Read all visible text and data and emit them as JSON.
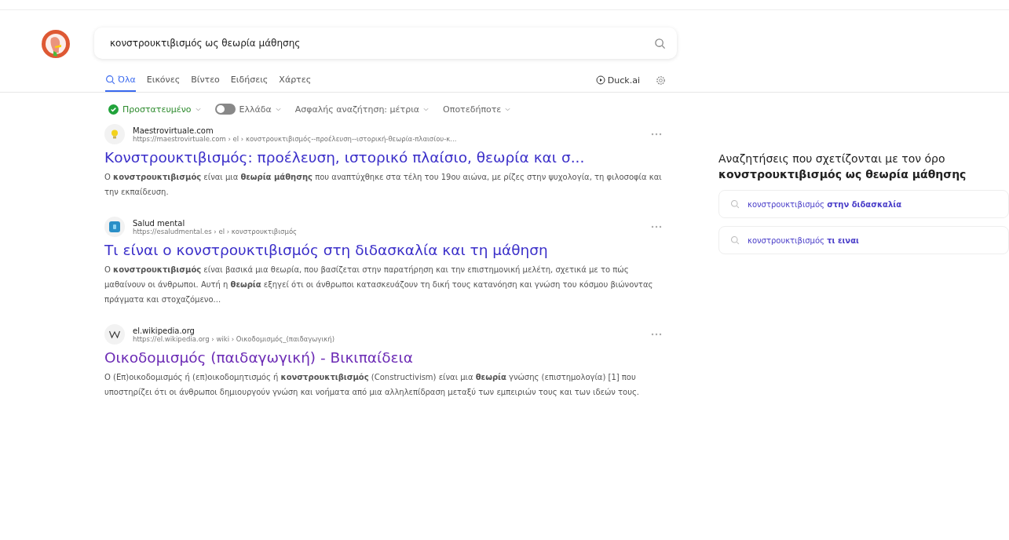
{
  "search": {
    "value": "κονστρουκτιβισμός ως θεωρία μάθησης"
  },
  "tabs": [
    {
      "label": "Όλα",
      "selected": true
    },
    {
      "label": "Εικόνες",
      "selected": false
    },
    {
      "label": "Βίντεο",
      "selected": false
    },
    {
      "label": "Ειδήσεις",
      "selected": false
    },
    {
      "label": "Χάρτες",
      "selected": false
    }
  ],
  "duck_ai": "Duck.ai",
  "filters": [
    {
      "kind": "protected",
      "label": "Προστατευμένο"
    },
    {
      "kind": "toggle",
      "label": "Ελλάδα",
      "on": false
    },
    {
      "kind": "plain",
      "label": "Ασφαλής αναζήτηση: μέτρια"
    },
    {
      "kind": "plain",
      "label": "Οποτεδήποτε"
    }
  ],
  "results": [
    {
      "kind": "bulb",
      "site": "Maestrovirtuale.com",
      "url": "https://maestrovirtuale.com › el › κονστρουκτιβισμός--προέλευση--ιστορική-θεωρία-πλαισίου-κ...",
      "title": "Κονστρουκτιβισμός: προέλευση, ιστορικό πλαίσιο, θεωρία και σ...",
      "visited": false,
      "snippet": "Ο **κονστρουκτιβισμός** είναι μια **θεωρία μάθησης** που αναπτύχθηκε στα τέλη του 19ου αιώνα, με ρίζες στην ψυχολογία, τη φιλοσοφία και την εκπαίδευση."
    },
    {
      "kind": "square",
      "site": "Salud mental",
      "url": "https://esaludmental.es › el › κονστρουκτιβισμός",
      "title": "Τι είναι ο κονστρουκτιβισμός στη διδασκαλία και τη μάθηση",
      "visited": false,
      "snippet": "Ο **κονστρουκτιβισμός** είναι βασικά μια θεωρία, που βασίζεται στην παρατήρηση και την επιστημονική μελέτη, σχετικά με το πώς μαθαίνουν οι άνθρωποι. Αυτή η **θεωρία** εξηγεί ότι οι άνθρωποι κατασκευάζουν τη δική τους κατανόηση και γνώση του κόσμου βιώνοντας πράγματα και στοχαζόμενο..."
    },
    {
      "kind": "wiki",
      "site": "el.wikipedia.org",
      "url": "https://el.wikipedia.org › wiki › Οικοδομισμός_(παιδαγωγική)",
      "title": "Οικοδομισμός (παιδαγωγική) - Βικιπαίδεια",
      "visited": true,
      "snippet": "Ο (Επ)οικοδομισμός ή (επ)οικοδομητισμός ή **κονστρουκτιβισμός** (Constructivism) είναι μια **θεωρία** γνώσης (επιστημολογία) [1] που υποστηρίζει ότι οι άνθρωποι δημιουργούν γνώση και νοήματα από μια αλληλεπίδραση μεταξύ των εμπειριών τους και των ιδεών τους."
    }
  ],
  "related": {
    "title": "Αναζητήσεις που σχετίζονται με τον όρο",
    "query": "κονστρουκτιβισμός ως θεωρία μάθησης",
    "items": [
      "κονστρουκτιβισμός **στην διδασκαλία**",
      "κονστρουκτιβισμός **τι ειναι**"
    ]
  }
}
